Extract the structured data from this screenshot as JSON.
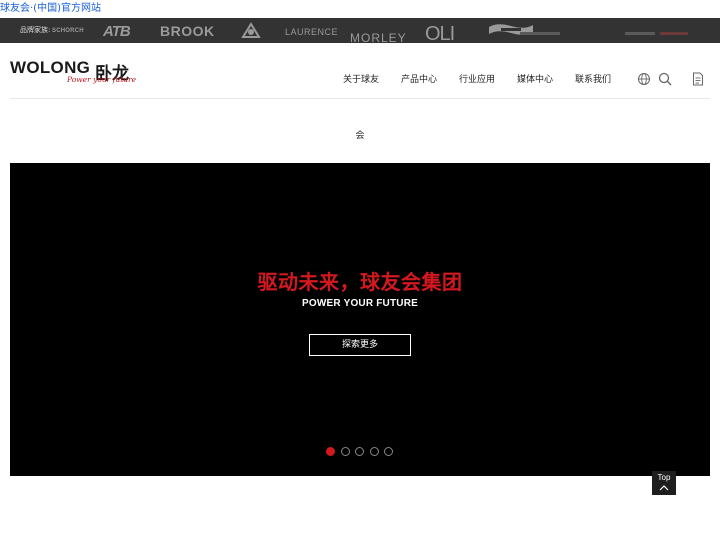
{
  "top_link": "球友会·(中国)官方网站",
  "brand_bar": {
    "label": "品牌家族:",
    "brands": [
      "SCHORCH",
      "ATB",
      "BROOK",
      "LAURENCE",
      "MORLEY",
      "OLI"
    ]
  },
  "logo": {
    "wordmark": "WOLONG",
    "cn": "卧龙",
    "slogan": "Power your future"
  },
  "nav": {
    "items": [
      {
        "label": "关于球友"
      },
      {
        "label": "产品中心"
      },
      {
        "label": "行业应用"
      },
      {
        "label": "媒体中心"
      },
      {
        "label": "联系我们"
      }
    ]
  },
  "section_title": "会",
  "banner": {
    "headline": "驱动未来，球友会集团",
    "subheadline": "POWER YOUR FUTURE",
    "button_label": "探索更多",
    "slide_count": 5,
    "active_slide": 1
  },
  "back_to_top": {
    "label": "Top"
  },
  "colors": {
    "accent": "#d4181f",
    "brand_bar": "#333333",
    "banner_bg": "#000000",
    "link": "#1a5fd6"
  }
}
